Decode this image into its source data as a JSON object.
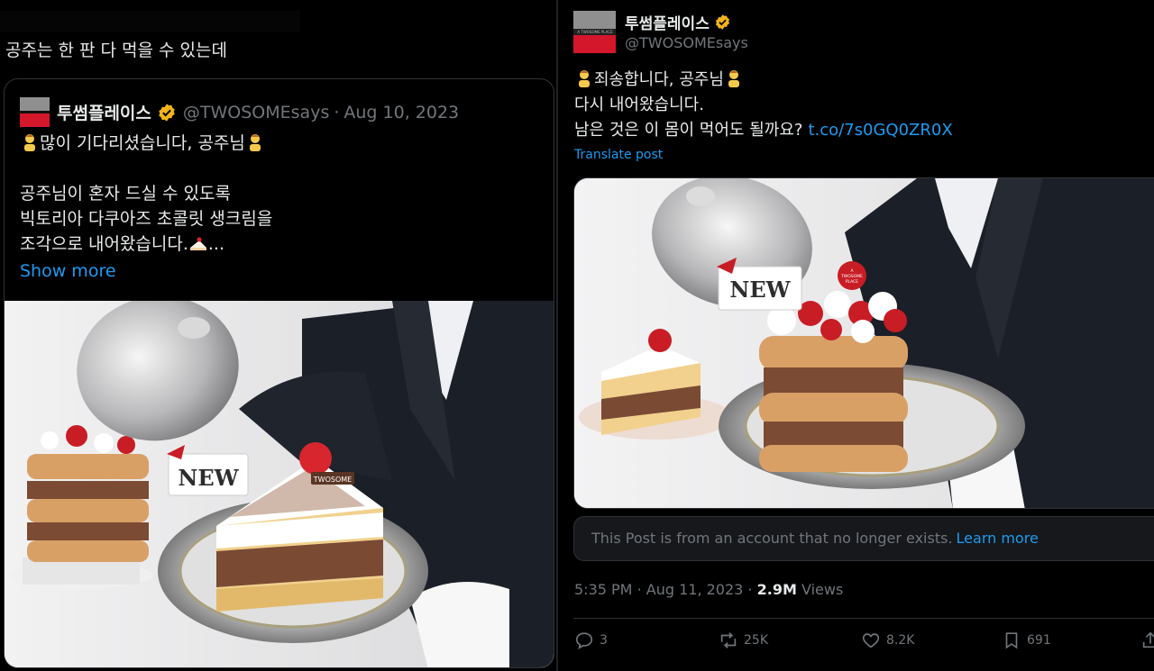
{
  "left": {
    "post_text": "공주는 한 판 다 먹을 수 있는데",
    "quote": {
      "display_name": "투썸플레이스",
      "handle": "@TWOSOMEsays",
      "separator": "·",
      "date": "Aug 10, 2023",
      "line1": "많이 기다리셨습니다, 공주님",
      "line2": "공주님이 혼자 드실 수 있도록",
      "line3": "빅토리아 다쿠아즈 초콜릿 생크림을",
      "line4": "조각으로 내어왔습니다.",
      "line4_tail": "...",
      "show_more": "Show more",
      "media": {
        "new_tag": "NEW",
        "brand_tag": "TWOSOME"
      }
    }
  },
  "right": {
    "display_name": "투썸플레이스",
    "handle": "@TWOSOMEsays",
    "line1": "죄송합니다, 공주님",
    "line2": "다시 내어왔습니다.",
    "line3": "남은 것은 이 몸이 먹어도 될까요?",
    "link": "t.co/7s0GQ0ZR0X",
    "translate": "Translate post",
    "media": {
      "new_tag": "NEW",
      "badge_line1": "A",
      "badge_line2": "TWOSOME",
      "badge_line3": "PLACE"
    },
    "notice_text": "This Post is from an account that no longer exists.",
    "notice_link": "Learn more",
    "time": "5:35 PM",
    "dot": "·",
    "date": "Aug 11, 2023",
    "views_count": "2.9M",
    "views_label": "Views",
    "replies": "3",
    "reposts": "25K",
    "likes": "8.2K",
    "bookmarks": "691"
  },
  "icons": [
    "verified-badge-icon",
    "person-bowing-emoji-icon",
    "cake-emoji-icon",
    "reply-icon",
    "repost-icon",
    "like-icon",
    "bookmark-icon",
    "share-icon"
  ],
  "colors": {
    "accent": "#1d9bf0",
    "verified": "#f4b41a",
    "brand_red": "#d4172b",
    "muted": "#71767b",
    "text": "#e7e9ea"
  }
}
